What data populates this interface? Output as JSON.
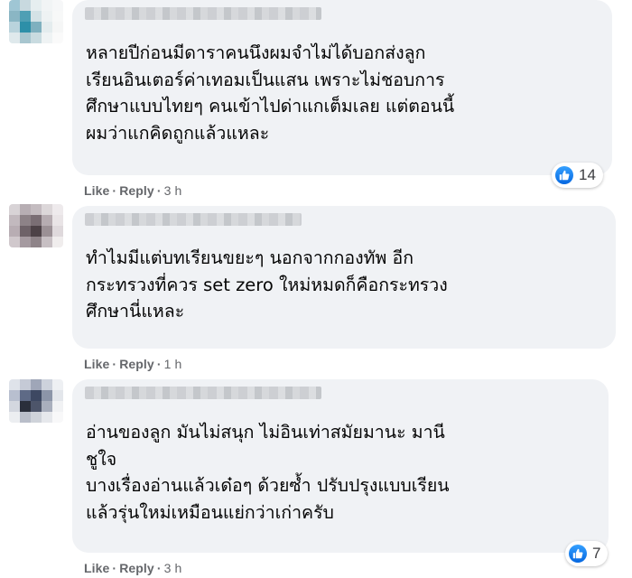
{
  "comments": [
    {
      "text": "หลายปีก่อนมีดาราคนนึงผมจำไม่ได้บอกส่งลูก\nเรียนอินเตอร์ค่าเทอมเป็นแสน เพราะไม่ชอบการ\nศึกษาแบบไทยๆ คนเข้าไปด่าแกเต็มเลย แต่ตอนนี้\nผมว่าแกคิดถูกแล้วแหละ",
      "like_label": "Like",
      "reply_label": "Reply",
      "time": "3 h",
      "reaction_icon": "like-icon",
      "reaction_count": "14"
    },
    {
      "text": "ทำไมมีแต่บทเรียนขยะๆ นอกจากกองทัพ อีก\nกระทรวงที่ควร set zero ใหม่หมดก็คือกระทรวง\nศึกษานี่แหละ",
      "like_label": "Like",
      "reply_label": "Reply",
      "time": "1 h"
    },
    {
      "text": "อ่านของลูก มันไม่สนุก ไม่อินเท่าสมัยมานะ มานี\nชูใจ\nบางเรื่องอ่านแล้วเด๋อๆ ด้วยซ้ำ ปรับปรุงแบบเรียน\nแล้วรุ่นใหม่เหมือนแย่กว่าเก่าครับ",
      "like_label": "Like",
      "reply_label": "Reply",
      "time": "3 h",
      "reaction_icon": "like-icon",
      "reaction_count": "7"
    }
  ],
  "colors": {
    "bubble": "#f0f2f5",
    "meta_text": "#65676b",
    "like_blue": "#1877f2"
  }
}
